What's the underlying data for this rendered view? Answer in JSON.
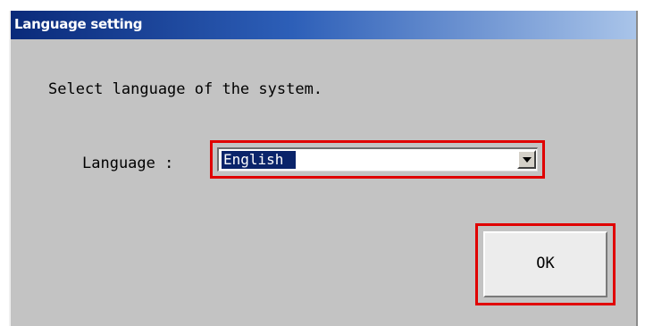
{
  "window": {
    "title": "Language setting"
  },
  "prompt": "Select language of the system.",
  "language": {
    "label": "Language :",
    "selected": "English"
  },
  "buttons": {
    "ok_label": "OK"
  },
  "colors": {
    "highlight": "#e00000",
    "selection": "#0a246a",
    "dialog_bg": "#c3c3c3"
  }
}
